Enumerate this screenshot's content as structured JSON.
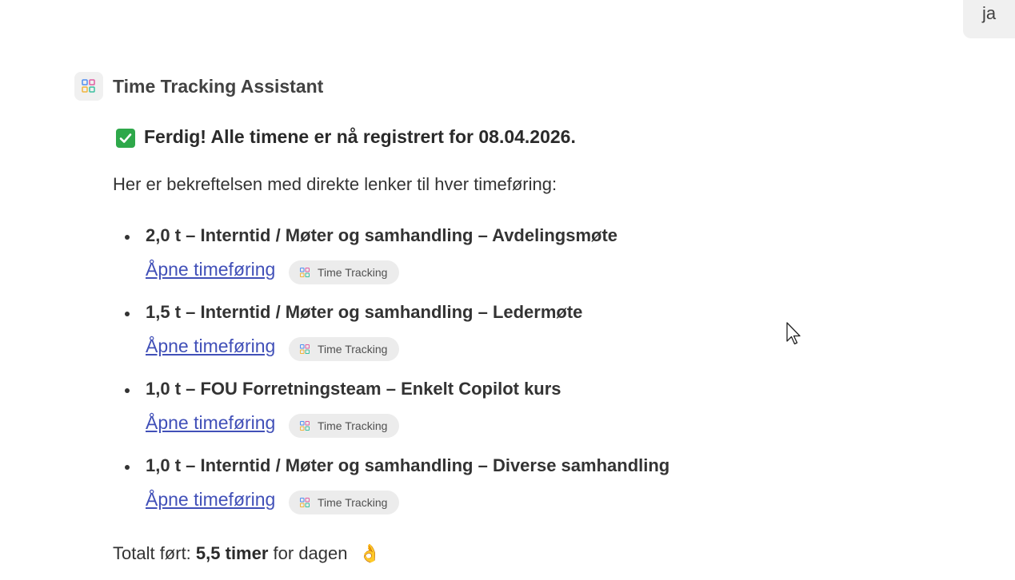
{
  "user_message": {
    "text": "ja"
  },
  "agent": {
    "name": "Time Tracking Assistant",
    "avatar_icon": "apps-grid-icon"
  },
  "response": {
    "headline_icon": "check-mark-button-icon",
    "headline": "Ferdig! Alle timene er nå registrert for 08.04.2026.",
    "intro": "Her er bekreftelsen med direkte lenker til hver timeføring:",
    "entries": [
      {
        "title": "2,0 t – Interntid / Møter og samhandling – Avdelingsmøte",
        "link": "Åpne timeføring",
        "source": "Time Tracking"
      },
      {
        "title": "1,5 t – Interntid / Møter og samhandling – Ledermøte",
        "link": "Åpne timeføring",
        "source": "Time Tracking"
      },
      {
        "title": "1,0 t – FOU Forretningsteam – Enkelt Copilot kurs",
        "link": "Åpne timeføring",
        "source": "Time Tracking"
      },
      {
        "title": "1,0 t – Interntid / Møter og samhandling – Diverse samhandling",
        "link": "Åpne timeføring",
        "source": "Time Tracking"
      }
    ],
    "total_prefix": "Totalt ført: ",
    "total_value": "5,5 timer",
    "total_suffix": " for dagen ",
    "total_emoji": "👌"
  },
  "colors": {
    "link": "#4150b8",
    "check": "#2ea84a",
    "chip_bg": "#ececec"
  }
}
